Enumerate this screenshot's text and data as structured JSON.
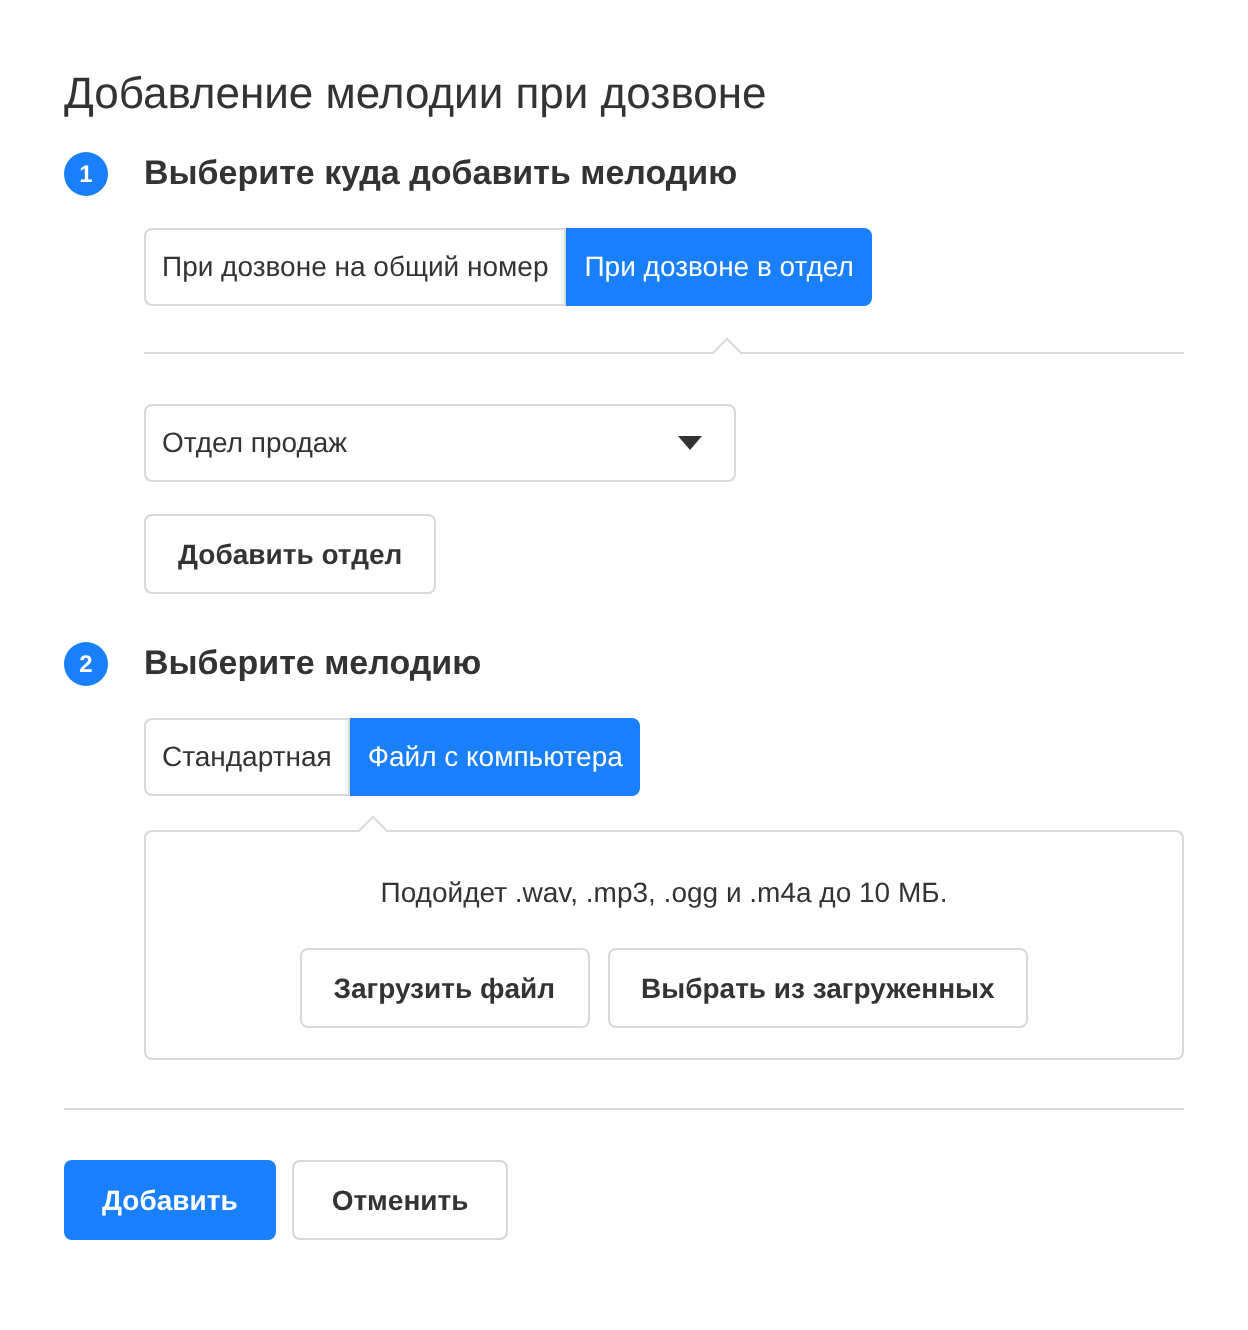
{
  "title": "Добавление мелодии при дозвоне",
  "steps": [
    {
      "number": "1",
      "heading": "Выберите куда добавить мелодию",
      "tabs": [
        {
          "label": "При дозвоне на общий номер",
          "selected": false
        },
        {
          "label": "При дозвоне в отдел",
          "selected": true
        }
      ],
      "select": {
        "value": "Отдел продаж"
      },
      "button": "Добавить отдел"
    },
    {
      "number": "2",
      "heading": "Выберите мелодию",
      "tabs": [
        {
          "label": "Стандартная",
          "selected": false
        },
        {
          "label": "Файл с компьютера",
          "selected": true
        }
      ],
      "panel": {
        "hint": "Подойдет .wav, .mp3, .ogg и .m4a до 10 МБ.",
        "buttons": [
          "Загрузить файл",
          "Выбрать из загруженных"
        ]
      }
    }
  ],
  "actions": [
    {
      "label": "Добавить",
      "kind": "primary"
    },
    {
      "label": "Отменить",
      "kind": "secondary"
    }
  ]
}
